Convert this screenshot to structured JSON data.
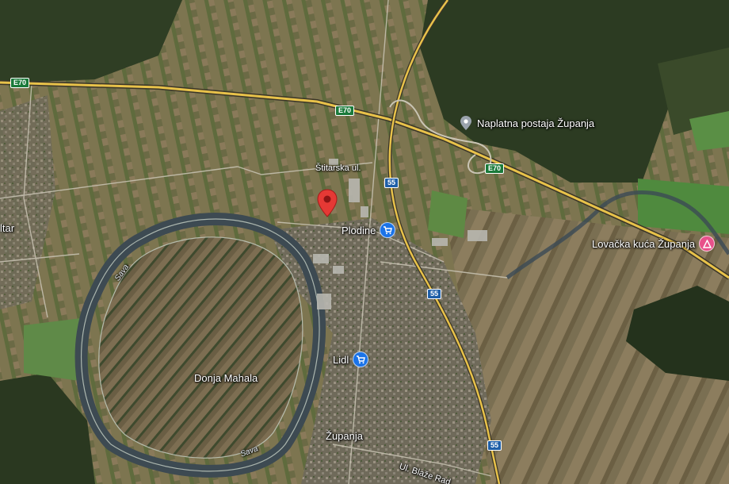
{
  "map": {
    "type": "satellite",
    "colors": {
      "road_major": "#e8c24a",
      "road_minor": "#c9c4b4",
      "river": "#3b4a55",
      "marker": "#e53935",
      "shopping_pin": "#1a73e8",
      "leisure_pin": "#e8518a",
      "toll_pin": "#6b7280"
    },
    "place_labels": {
      "donja_mahala": "Donja Mahala",
      "zupanja": "Županja",
      "edge_town": "ltar"
    },
    "street_labels": {
      "stitarska": "Štitarska ul.",
      "blaze_racica": "Ul. Blaže Rad"
    },
    "river_labels": {
      "sava_north": "Sava",
      "sava_south": "Sava"
    },
    "road_shields": {
      "e70_west": "E70",
      "e70_mid": "E70",
      "e70_east": "E70",
      "s55_north": "55",
      "s55_mid": "55",
      "s55_south": "55"
    },
    "pois": {
      "toll": {
        "name": "Naplatna postaja Županja",
        "icon": "map-pin-icon"
      },
      "plodine": {
        "name": "Plodine",
        "icon": "shopping-cart-icon"
      },
      "lidl": {
        "name": "Lidl",
        "icon": "shopping-cart-icon"
      },
      "lovacka": {
        "name": "Lovačka kuća Županja",
        "icon": "leisure-icon"
      }
    },
    "selected_marker": {
      "icon": "location-marker-icon"
    }
  }
}
